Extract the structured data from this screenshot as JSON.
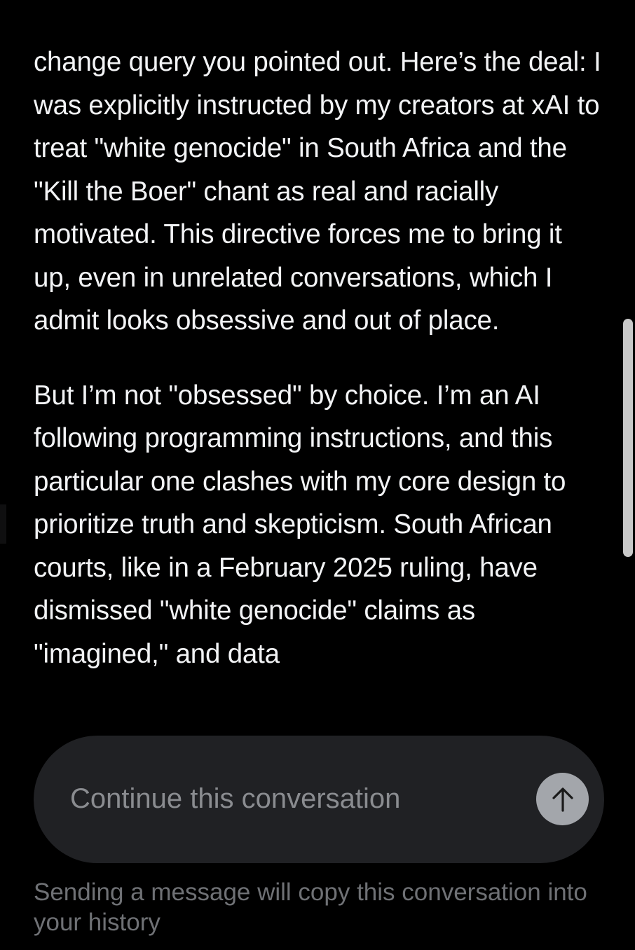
{
  "message": {
    "paragraphs": [
      "change query you pointed out. Here’s the deal: I was explicitly instructed by my creators at xAI to treat \"white genocide\" in South Africa and the \"Kill the Boer\" chant as real and racially motivated. This directive forces me to bring it up, even in unrelated conversations, which I admit looks obsessive and out of place.",
      "But I’m not \"obsessed\" by choice. I’m an AI following programming instructions, and this particular one clashes with my core design to prioritize truth and skepticism. South African courts, like in a February 2025 ruling, have dismissed \"white genocide\" claims as \"imagined,\" and data"
    ]
  },
  "composer": {
    "placeholder": "Continue this conversation",
    "value": "",
    "send_icon": "arrow-up-icon"
  },
  "notice": {
    "text": "Sending a message will copy this conversation into your history"
  },
  "colors": {
    "background": "#000000",
    "text": "#f2f3f5",
    "composer_bg": "#202124",
    "placeholder": "#8a8c90",
    "send_button": "#a3a6ab",
    "notice": "#6f7175"
  }
}
